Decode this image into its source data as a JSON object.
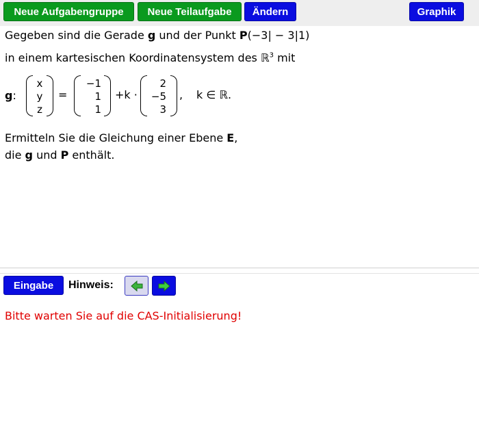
{
  "toolbar": {
    "new_group_label": "Neue Aufgabengruppe",
    "new_subtask_label": "Neue Teilaufgabe",
    "change_label": "Ändern",
    "graph_label": "Graphik"
  },
  "task": {
    "line1": {
      "before_g": "Gegeben sind die Gerade ",
      "g": "g",
      "between": " und der Punkt ",
      "P": "P",
      "coords": "(−3| − 3|1)"
    },
    "line2": {
      "text": "in einem kartesischen Koordinatensystem des ",
      "R": "ℝ",
      "exp": "3",
      "after": " mit"
    },
    "equation": {
      "label": "g",
      "colon": ":",
      "lhs": [
        "x",
        "y",
        "z"
      ],
      "equals": "=",
      "support": [
        "−1",
        "1",
        "1"
      ],
      "plus_k": "+k ·",
      "direction": [
        "2",
        "−5",
        "3"
      ],
      "comma": ",",
      "domain": "k ∈ ℝ."
    },
    "line3": {
      "before": "Ermitteln Sie die Gleichung einer Ebene ",
      "E": "E",
      "after": ","
    },
    "line4": {
      "before": "die ",
      "g": "g",
      "mid": " und ",
      "P": "P",
      "after": " enthält."
    }
  },
  "input": {
    "eingabe_label": "Eingabe",
    "hint_label": "Hinweis:",
    "prev_icon": "left-arrow-icon",
    "next_icon": "right-arrow-icon"
  },
  "status": {
    "message": "Bitte warten Sie auf die CAS-Initialisierung!"
  },
  "colors": {
    "green_button": "#0a9a1e",
    "blue_button": "#0a0de0",
    "status_red": "#e00000",
    "topbar_bg": "#eeeeee"
  }
}
